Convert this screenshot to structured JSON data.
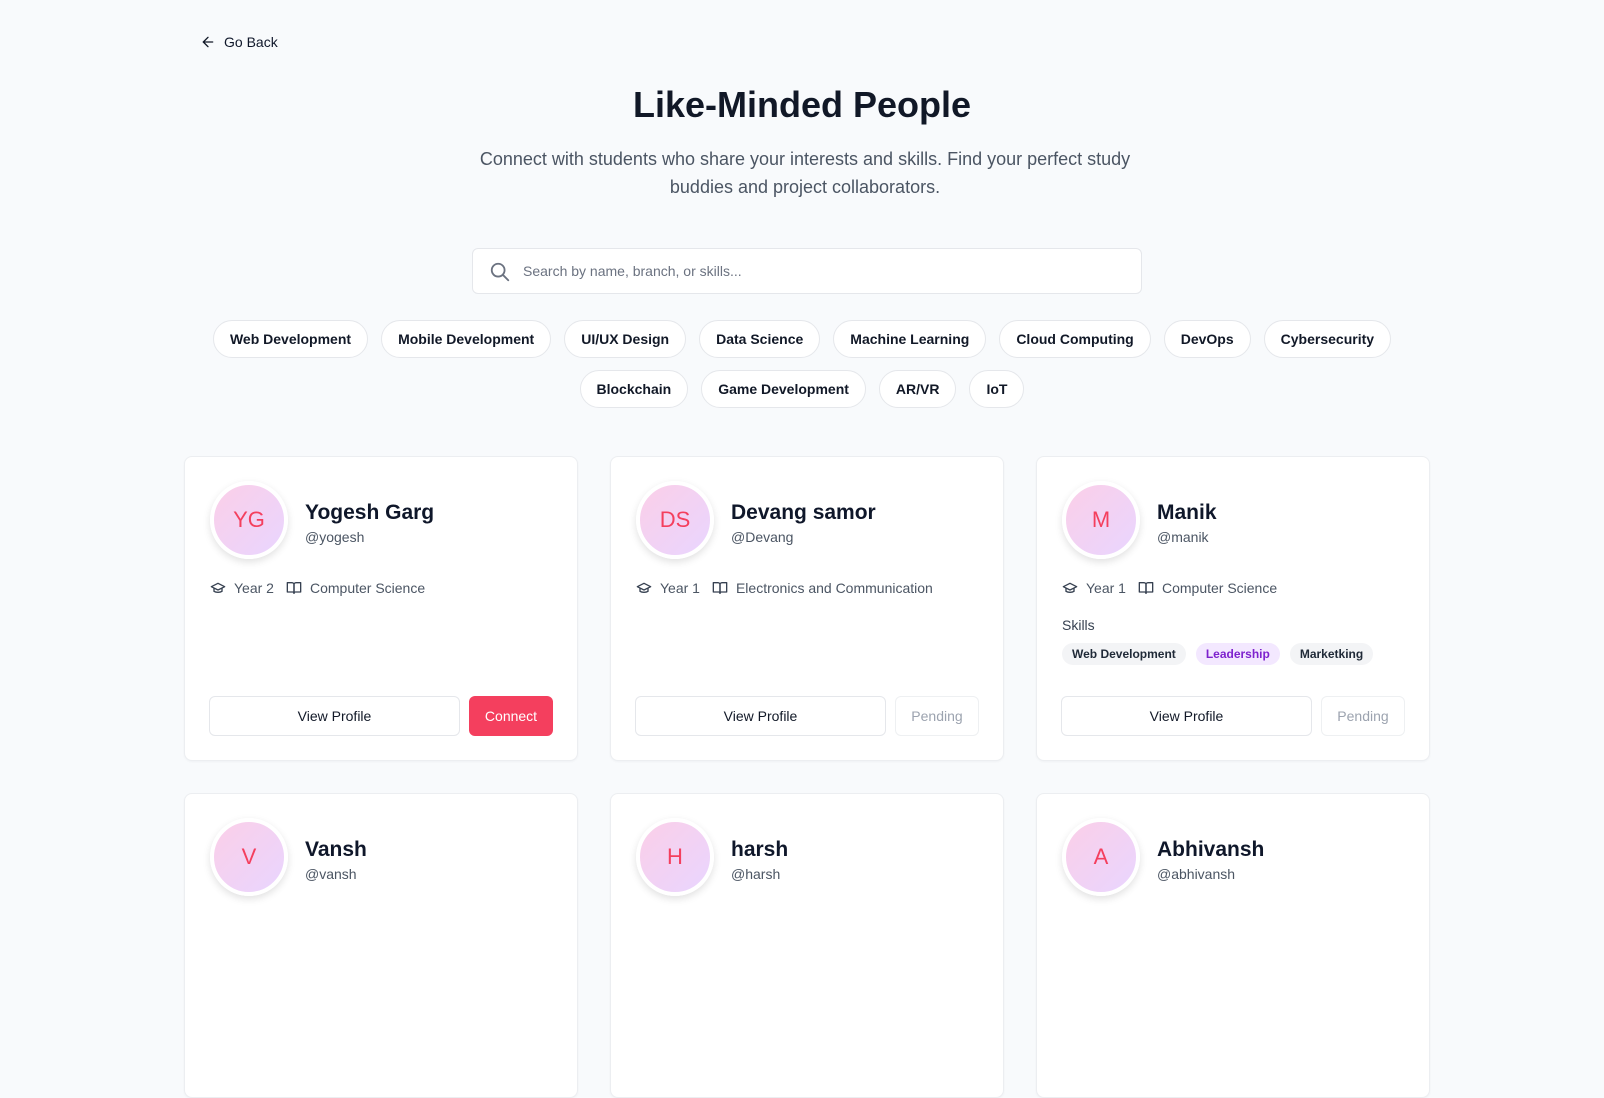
{
  "nav": {
    "back_label": "Go Back"
  },
  "header": {
    "title": "Like-Minded People",
    "subtitle": "Connect with students who share your interests and skills. Find your perfect study buddies and project collaborators."
  },
  "search": {
    "placeholder": "Search by name, branch, or skills...",
    "value": ""
  },
  "filters": [
    "Web Development",
    "Mobile Development",
    "UI/UX Design",
    "Data Science",
    "Machine Learning",
    "Cloud Computing",
    "DevOps",
    "Cybersecurity",
    "Blockchain",
    "Game Development",
    "AR/VR",
    "IoT"
  ],
  "labels": {
    "skills": "Skills",
    "view_profile": "View Profile",
    "connect": "Connect",
    "pending": "Pending"
  },
  "people": [
    {
      "initials": "YG",
      "name": "Yogesh Garg",
      "handle": "@yogesh",
      "year": "Year 2",
      "branch": "Computer Science",
      "skills": [],
      "status": "Connect"
    },
    {
      "initials": "DS",
      "name": "Devang samor",
      "handle": "@Devang",
      "year": "Year 1",
      "branch": "Electronics and Communication",
      "skills": [],
      "status": "Pending"
    },
    {
      "initials": "M",
      "name": "Manik",
      "handle": "@manik",
      "year": "Year 1",
      "branch": "Computer Science",
      "skills": [
        "Web Development",
        "Leadership",
        "Marketking"
      ],
      "status": "Pending"
    },
    {
      "initials": "V",
      "name": "Vansh",
      "handle": "@vansh"
    },
    {
      "initials": "H",
      "name": "harsh",
      "handle": "@harsh"
    },
    {
      "initials": "A",
      "name": "Abhivansh",
      "handle": "@abhivansh"
    }
  ],
  "colors": {
    "accent": "#f43f5e",
    "skill_accent": "#7e22ce"
  },
  "icons": {
    "back": "arrow-left-icon",
    "search": "search-icon",
    "year": "graduation-cap-icon",
    "branch": "book-open-icon"
  }
}
